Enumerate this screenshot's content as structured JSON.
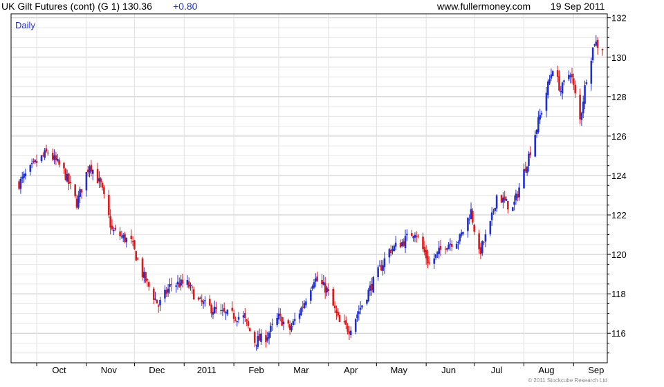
{
  "header": {
    "symbol_text": "UK Gilt Futures (cont) (G 1) 130.36",
    "change_text": "+0.80",
    "site": "www.fullermoney.com",
    "date": "19 Sep 2011"
  },
  "footer": {
    "copyright": "© 2011 Stockcube Research Ltd"
  },
  "colors": {
    "up": "#1f2fd6",
    "down": "#e01818",
    "grid": "#dcdcdc",
    "axis": "#000000"
  },
  "chart_data": {
    "type": "candlestick",
    "period_label": "Daily",
    "x_ticks": [
      "Oct",
      "Nov",
      "Dec",
      "2011",
      "Feb",
      "Mar",
      "Apr",
      "May",
      "Jun",
      "Jul",
      "Aug",
      "Sep"
    ],
    "y_ticks": [
      116,
      118,
      120,
      122,
      124,
      126,
      128,
      130,
      132
    ],
    "ylim": [
      114.5,
      132.2
    ],
    "last_price": 130.36,
    "change": 0.8,
    "close_path": [
      [
        "2010-09-20",
        123.6
      ],
      [
        "2010-09-30",
        124.6
      ],
      [
        "2010-10-08",
        125.2
      ],
      [
        "2010-10-18",
        124.2
      ],
      [
        "2010-10-26",
        122.6
      ],
      [
        "2010-11-03",
        124.6
      ],
      [
        "2010-11-10",
        123.5
      ],
      [
        "2010-11-17",
        121.2
      ],
      [
        "2010-11-29",
        120.6
      ],
      [
        "2010-12-06",
        119.0
      ],
      [
        "2010-12-16",
        117.4
      ],
      [
        "2010-12-24",
        118.5
      ],
      [
        "2011-01-03",
        118.5
      ],
      [
        "2011-01-10",
        117.6
      ],
      [
        "2011-01-24",
        117.0
      ],
      [
        "2011-02-07",
        116.8
      ],
      [
        "2011-02-14",
        115.6
      ],
      [
        "2011-02-21",
        115.8
      ],
      [
        "2011-03-01",
        116.8
      ],
      [
        "2011-03-08",
        116.2
      ],
      [
        "2011-03-16",
        117.4
      ],
      [
        "2011-03-23",
        118.8
      ],
      [
        "2011-03-31",
        118.2
      ],
      [
        "2011-04-08",
        116.5
      ],
      [
        "2011-04-14",
        116.2
      ],
      [
        "2011-04-21",
        117.3
      ],
      [
        "2011-04-29",
        118.6
      ],
      [
        "2011-05-09",
        120.2
      ],
      [
        "2011-05-17",
        120.6
      ],
      [
        "2011-05-25",
        121.2
      ],
      [
        "2011-06-03",
        119.5
      ],
      [
        "2011-06-13",
        120.5
      ],
      [
        "2011-06-22",
        120.8
      ],
      [
        "2011-06-29",
        122.2
      ],
      [
        "2011-07-04",
        120.0
      ],
      [
        "2011-07-11",
        121.5
      ],
      [
        "2011-07-15",
        123.0
      ],
      [
        "2011-07-25",
        122.3
      ],
      [
        "2011-08-04",
        125.0
      ],
      [
        "2011-08-12",
        127.3
      ],
      [
        "2011-08-19",
        129.5
      ],
      [
        "2011-08-24",
        128.3
      ],
      [
        "2011-08-30",
        129.3
      ],
      [
        "2011-09-05",
        126.8
      ],
      [
        "2011-09-09",
        129.0
      ],
      [
        "2011-09-14",
        130.8
      ],
      [
        "2011-09-19",
        130.36
      ]
    ]
  }
}
